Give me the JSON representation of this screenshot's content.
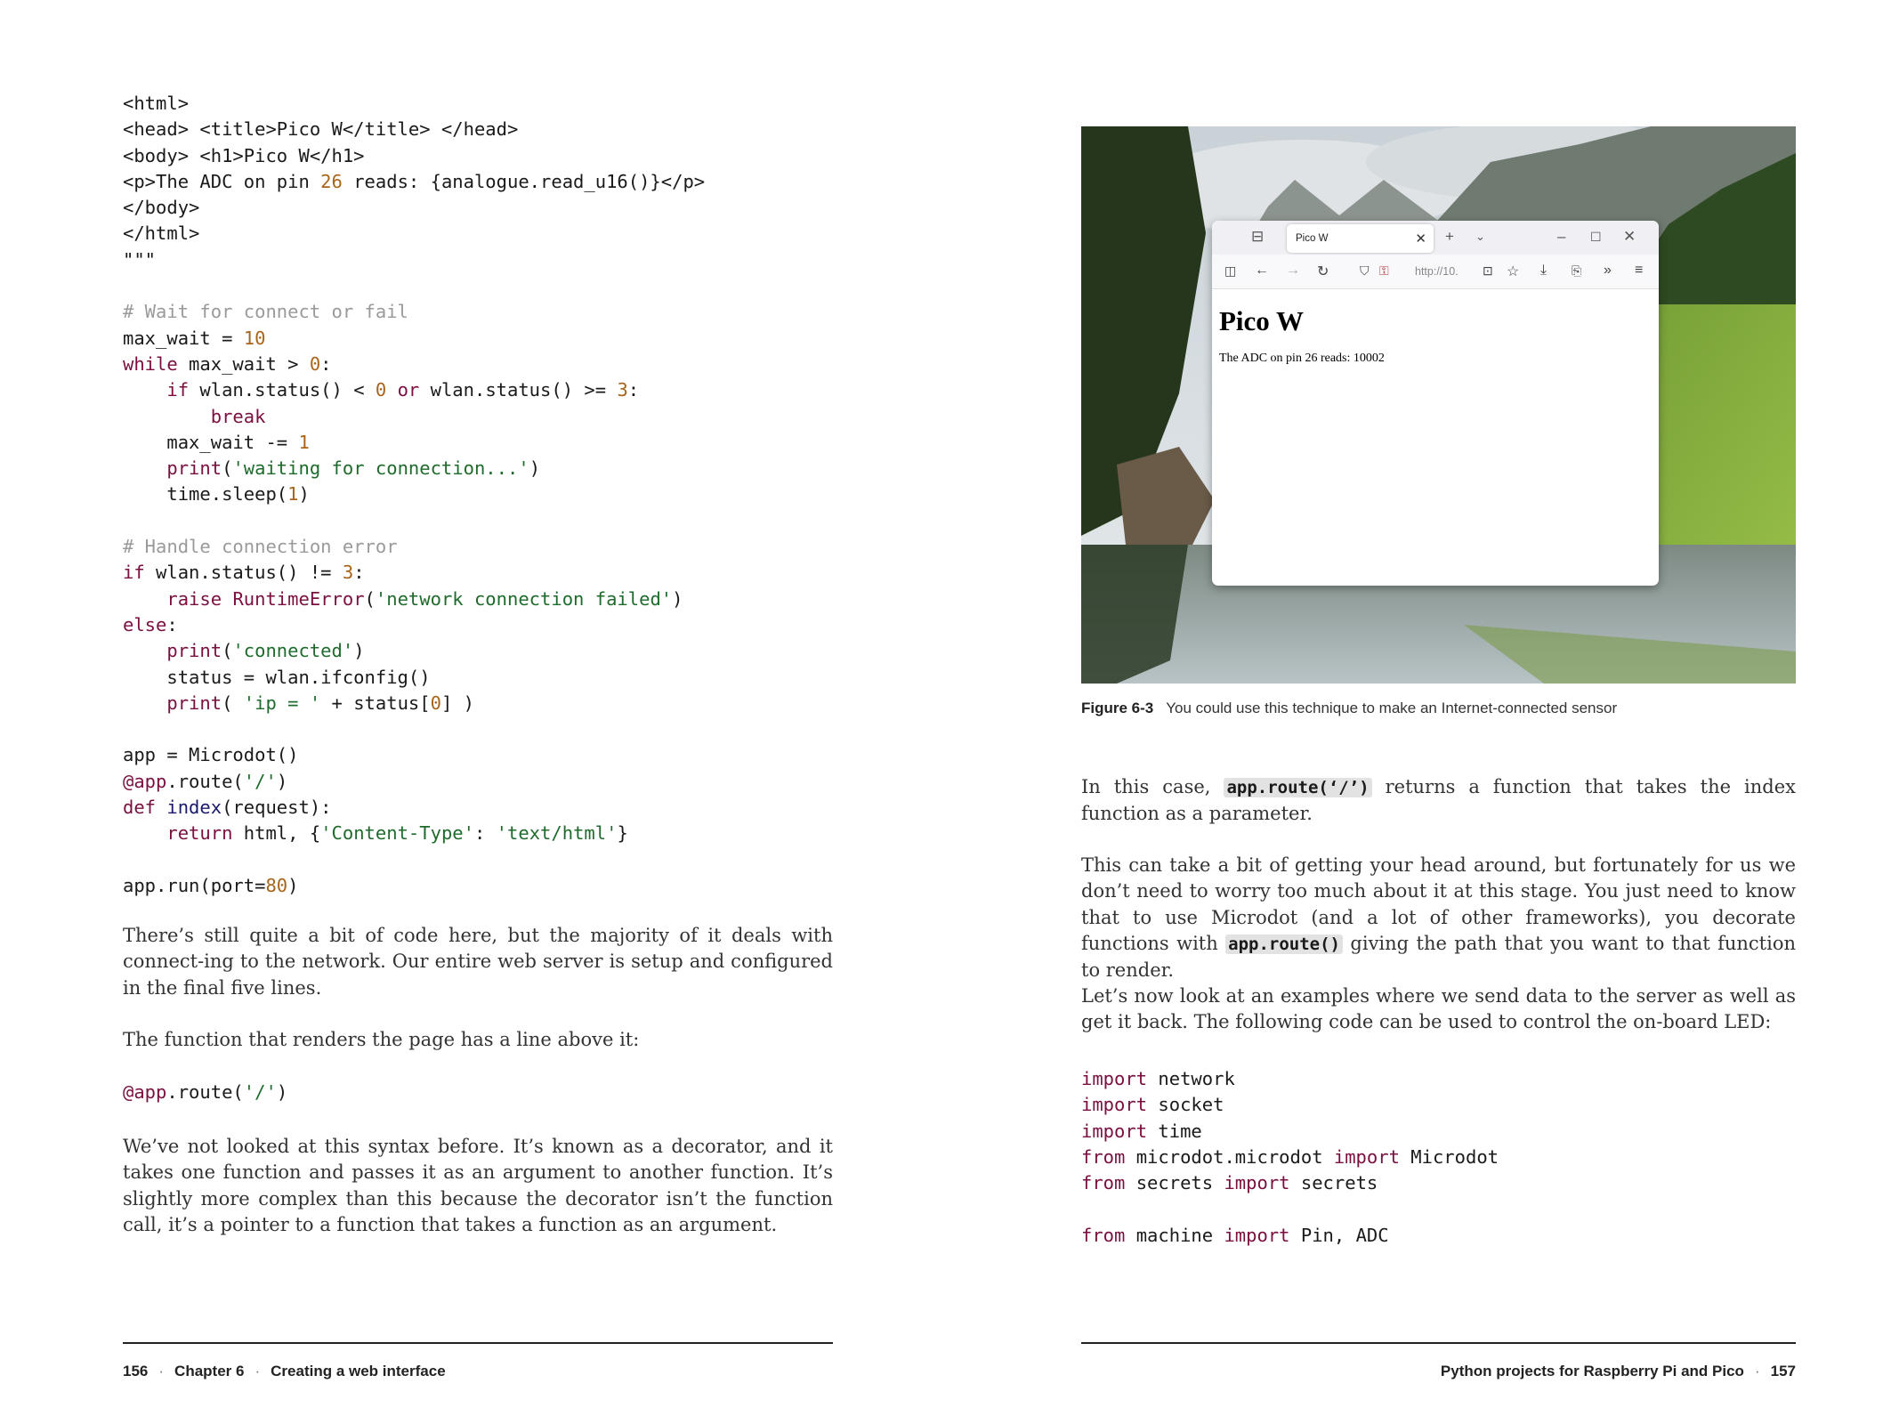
{
  "left_page": {
    "code_block_1": [
      [
        {
          "t": "<html>"
        }
      ],
      [
        {
          "t": "<head> <title>Pico W</title> </head>"
        }
      ],
      [
        {
          "t": "<body> <h1>Pico W</h1>"
        }
      ],
      [
        {
          "t": "<p>The ADC on pin "
        },
        {
          "t": "26",
          "c": "num"
        },
        {
          "t": " reads: {analogue.read_u16()}</p>"
        }
      ],
      [
        {
          "t": "</body>"
        }
      ],
      [
        {
          "t": "</html>"
        }
      ],
      [
        {
          "t": "\"\"\""
        }
      ],
      [
        {
          "t": ""
        }
      ],
      [
        {
          "t": "# Wait for connect or fail",
          "c": "cm"
        }
      ],
      [
        {
          "t": "max_wait = "
        },
        {
          "t": "10",
          "c": "num"
        }
      ],
      [
        {
          "t": "while",
          "c": "kw"
        },
        {
          "t": " max_wait > "
        },
        {
          "t": "0",
          "c": "num"
        },
        {
          "t": ":"
        }
      ],
      [
        {
          "t": "    "
        },
        {
          "t": "if",
          "c": "kw"
        },
        {
          "t": " wlan.status() < "
        },
        {
          "t": "0",
          "c": "num"
        },
        {
          "t": " "
        },
        {
          "t": "or",
          "c": "kw"
        },
        {
          "t": " wlan.status() >= "
        },
        {
          "t": "3",
          "c": "num"
        },
        {
          "t": ":"
        }
      ],
      [
        {
          "t": "        "
        },
        {
          "t": "break",
          "c": "kw"
        }
      ],
      [
        {
          "t": "    max_wait -= "
        },
        {
          "t": "1",
          "c": "num"
        }
      ],
      [
        {
          "t": "    "
        },
        {
          "t": "print",
          "c": "kw"
        },
        {
          "t": "("
        },
        {
          "t": "'waiting for connection...'",
          "c": "str"
        },
        {
          "t": ")"
        }
      ],
      [
        {
          "t": "    time.sleep("
        },
        {
          "t": "1",
          "c": "num"
        },
        {
          "t": ")"
        }
      ],
      [
        {
          "t": ""
        }
      ],
      [
        {
          "t": "# Handle connection error",
          "c": "cm"
        }
      ],
      [
        {
          "t": "if",
          "c": "kw"
        },
        {
          "t": " wlan.status() != "
        },
        {
          "t": "3",
          "c": "num"
        },
        {
          "t": ":"
        }
      ],
      [
        {
          "t": "    "
        },
        {
          "t": "raise",
          "c": "kw"
        },
        {
          "t": " "
        },
        {
          "t": "RuntimeError",
          "c": "kw"
        },
        {
          "t": "("
        },
        {
          "t": "'network connection failed'",
          "c": "str"
        },
        {
          "t": ")"
        }
      ],
      [
        {
          "t": "else",
          "c": "kw"
        },
        {
          "t": ":"
        }
      ],
      [
        {
          "t": "    "
        },
        {
          "t": "print",
          "c": "kw"
        },
        {
          "t": "("
        },
        {
          "t": "'connected'",
          "c": "str"
        },
        {
          "t": ")"
        }
      ],
      [
        {
          "t": "    status = wlan.ifconfig()"
        }
      ],
      [
        {
          "t": "    "
        },
        {
          "t": "print",
          "c": "kw"
        },
        {
          "t": "( "
        },
        {
          "t": "'ip = '",
          "c": "str"
        },
        {
          "t": " + status["
        },
        {
          "t": "0",
          "c": "num"
        },
        {
          "t": "] )"
        }
      ],
      [
        {
          "t": ""
        }
      ],
      [
        {
          "t": "app = Microdot()"
        }
      ],
      [
        {
          "t": "@app",
          "c": "kw"
        },
        {
          "t": ".route("
        },
        {
          "t": "'/'",
          "c": "str"
        },
        {
          "t": ")"
        }
      ],
      [
        {
          "t": "def",
          "c": "kw"
        },
        {
          "t": " "
        },
        {
          "t": "index",
          "c": "fn"
        },
        {
          "t": "(request):"
        }
      ],
      [
        {
          "t": "    "
        },
        {
          "t": "return",
          "c": "kw"
        },
        {
          "t": " html, {"
        },
        {
          "t": "'Content-Type'",
          "c": "str"
        },
        {
          "t": ": "
        },
        {
          "t": "'text/html'",
          "c": "str"
        },
        {
          "t": "}"
        }
      ],
      [
        {
          "t": ""
        }
      ],
      [
        {
          "t": "app.run(port="
        },
        {
          "t": "80",
          "c": "num"
        },
        {
          "t": ")"
        }
      ]
    ],
    "para_1": "There’s still quite a bit of code here, but the majority of it deals with connect-ing to the network. Our entire web server is setup and configured in the final five lines.",
    "para_2": "The function that renders the page has a line above it:",
    "code_block_2": [
      [
        {
          "t": "@app",
          "c": "kw"
        },
        {
          "t": ".route("
        },
        {
          "t": "'/'",
          "c": "str"
        },
        {
          "t": ")"
        }
      ]
    ],
    "para_3": "We’ve not looked at this syntax before. It’s known as a decorator, and it takes one function and passes it as an argument to another function. It’s slightly more complex than this because the decorator isn’t the function call, it’s a pointer to a function that takes a function as an argument.",
    "footer": {
      "page_number": "156",
      "chapter": "Chapter 6",
      "chapter_title": "Creating a web interface"
    }
  },
  "right_page": {
    "figure": {
      "browser": {
        "tab_title": "Pico W",
        "url": "http://10.",
        "heading": "Pico W",
        "body_text": "The ADC on pin 26 reads: 10002"
      },
      "label": "Figure 6-3",
      "caption": "You could use this technique to make an Internet-connected sensor"
    },
    "para_1": {
      "before": "In this case, ",
      "code": "app.route(‘/’)",
      "after": " returns a function that takes the index function as a parameter."
    },
    "para_2": {
      "before": "This can take a bit of getting your head around, but fortunately for us we don’t need to worry too much about it at this stage. You just need to know that to use Microdot (and a lot of other frameworks), you decorate functions with ",
      "code": "app.route()",
      "after": " giving the path that you want to that function to render."
    },
    "para_3": "Let’s now look at an examples where we send data to the server as well as get it back. The following code can be used to control the on-board LED:",
    "code_block": [
      [
        {
          "t": "import",
          "c": "kw"
        },
        {
          "t": " network"
        }
      ],
      [
        {
          "t": "import",
          "c": "kw"
        },
        {
          "t": " socket"
        }
      ],
      [
        {
          "t": "import",
          "c": "kw"
        },
        {
          "t": " time"
        }
      ],
      [
        {
          "t": "from",
          "c": "kw"
        },
        {
          "t": " microdot.microdot "
        },
        {
          "t": "import",
          "c": "kw"
        },
        {
          "t": " Microdot"
        }
      ],
      [
        {
          "t": "from",
          "c": "kw"
        },
        {
          "t": " secrets "
        },
        {
          "t": "import",
          "c": "kw"
        },
        {
          "t": " secrets"
        }
      ],
      [
        {
          "t": ""
        }
      ],
      [
        {
          "t": "from",
          "c": "kw"
        },
        {
          "t": " machine "
        },
        {
          "t": "import",
          "c": "kw"
        },
        {
          "t": " Pin, ADC"
        }
      ]
    ],
    "footer": {
      "book_title": "Python projects for Raspberry Pi and Pico",
      "page_number": "157"
    }
  }
}
